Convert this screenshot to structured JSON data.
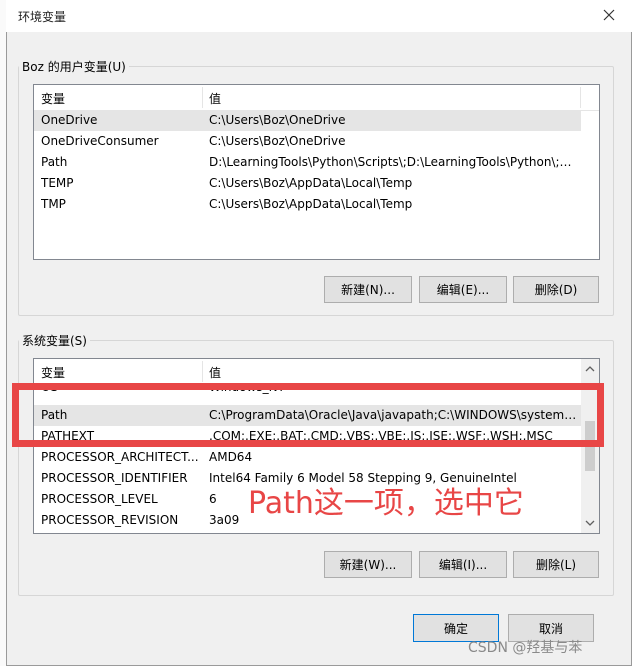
{
  "window": {
    "title": "环境变量"
  },
  "user_vars": {
    "legend": "Boz 的用户变量(U)",
    "columns": [
      "变量",
      "值"
    ],
    "rows": [
      [
        "OneDrive",
        "C:\\Users\\Boz\\OneDrive"
      ],
      [
        "OneDriveConsumer",
        "C:\\Users\\Boz\\OneDrive"
      ],
      [
        "Path",
        "D:\\LearningTools\\Python\\Scripts\\;D:\\LearningTools\\Python\\;C:..."
      ],
      [
        "TEMP",
        "C:\\Users\\Boz\\AppData\\Local\\Temp"
      ],
      [
        "TMP",
        "C:\\Users\\Boz\\AppData\\Local\\Temp"
      ]
    ],
    "buttons": {
      "new": "新建(N)...",
      "edit": "编辑(E)...",
      "delete": "删除(D)"
    }
  },
  "system_vars": {
    "legend": "系统变量(S)",
    "columns": [
      "变量",
      "值"
    ],
    "rows": [
      [
        "OS",
        "Windows_NT"
      ],
      [
        "Path",
        "C:\\ProgramData\\Oracle\\Java\\javapath;C:\\WINDOWS\\system3..."
      ],
      [
        "PATHEXT",
        ".COM;.EXE;.BAT;.CMD;.VBS;.VBE;.JS;.JSE;.WSF;.WSH;.MSC"
      ],
      [
        "PROCESSOR_ARCHITECT...",
        "AMD64"
      ],
      [
        "PROCESSOR_IDENTIFIER",
        "Intel64 Family 6 Model 58 Stepping 9, GenuineIntel"
      ],
      [
        "PROCESSOR_LEVEL",
        "6"
      ],
      [
        "PROCESSOR_REVISION",
        "3a09"
      ]
    ],
    "buttons": {
      "new": "新建(W)...",
      "edit": "编辑(I)...",
      "delete": "删除(L)"
    }
  },
  "footer": {
    "ok": "确定",
    "cancel": "取消"
  },
  "annotation": {
    "text": "Path这一项，选中它",
    "color": "#e84646"
  },
  "watermark": "CSDN @羟基与苯"
}
